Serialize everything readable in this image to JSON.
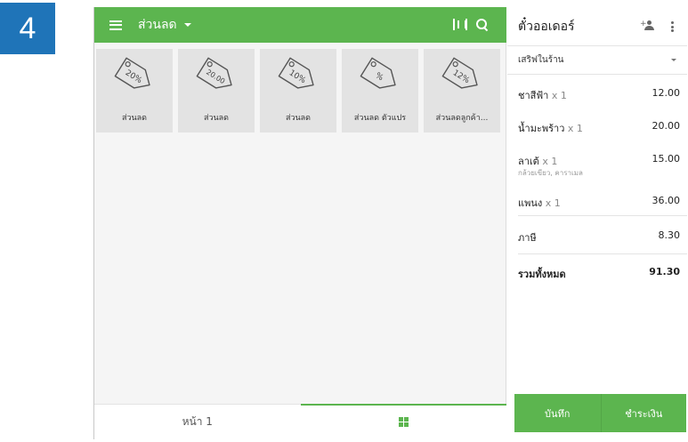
{
  "step_badge": "4",
  "topbar": {
    "title": "ส่วนลด",
    "icons": [
      "menu-icon",
      "barcode-icon",
      "search-icon"
    ]
  },
  "discounts": [
    {
      "tag_text": "20%",
      "label": "ส่วนลด"
    },
    {
      "tag_text": "20.00",
      "label": "ส่วนลด"
    },
    {
      "tag_text": "10%",
      "label": "ส่วนลด"
    },
    {
      "tag_text": "%",
      "label": "ส่วนลด ตัวแปร"
    },
    {
      "tag_text": "12%",
      "label": "ส่วนลดลูกค้า..."
    }
  ],
  "bottom_tabs": {
    "page_label": "หน้า 1",
    "grid_icon": "grid-icon"
  },
  "ticket": {
    "title": "ตั๋วออเดอร์",
    "dining_option": "เสริฟในร้าน",
    "items": [
      {
        "name": "ชาสีฟ้า",
        "qty": "x 1",
        "price": "12.00",
        "modifiers": ""
      },
      {
        "name": "น้ำมะพร้าว",
        "qty": "x 1",
        "price": "20.00",
        "modifiers": ""
      },
      {
        "name": "ลาเต้",
        "qty": "x 1",
        "price": "15.00",
        "modifiers": "กล้วยเขียว, คาราเมล"
      },
      {
        "name": "แพนง",
        "qty": "x 1",
        "price": "36.00",
        "modifiers": ""
      }
    ],
    "tax_label": "ภาษี",
    "tax_value": "8.30",
    "total_label": "รวมทั้งหมด",
    "total_value": "91.30",
    "save_label": "บันทึก",
    "charge_label": "ชำระเงิน"
  },
  "colors": {
    "accent": "#5cb54f",
    "badge": "#1f74b8",
    "tile": "#e3e3e3"
  }
}
